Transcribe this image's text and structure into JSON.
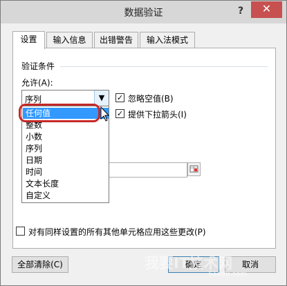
{
  "dialog": {
    "title": "数据验证",
    "help": "?",
    "close": "✕"
  },
  "tabs": [
    {
      "label": "设置",
      "active": true
    },
    {
      "label": "输入信息"
    },
    {
      "label": "出错警告"
    },
    {
      "label": "输入法模式"
    }
  ],
  "section": {
    "heading": "验证条件",
    "allow_label": "允许(A):"
  },
  "allow_select": {
    "value": "序列",
    "options": [
      "任何值",
      "整数",
      "小数",
      "序列",
      "日期",
      "时间",
      "文本长度",
      "自定义"
    ],
    "highlighted": "任何值"
  },
  "checkboxes": {
    "ignore_blank": {
      "label": "忽略空值(B)",
      "checked": true
    },
    "dropdown": {
      "label": "提供下拉箭头(I)",
      "checked": true
    },
    "apply_all": {
      "label": "对有同样设置的所有其他单元格应用这些更改(P)",
      "checked": false
    }
  },
  "buttons": {
    "clear_all": "全部清除(C)",
    "ok": "确定",
    "cancel": "取消"
  },
  "watermark": {
    "main": "我要IT技术网",
    "sub": "51edu.com"
  },
  "colors": {
    "selection": "#3399ff",
    "highlight_ring": "#c62828",
    "close_button": "#c75050"
  }
}
